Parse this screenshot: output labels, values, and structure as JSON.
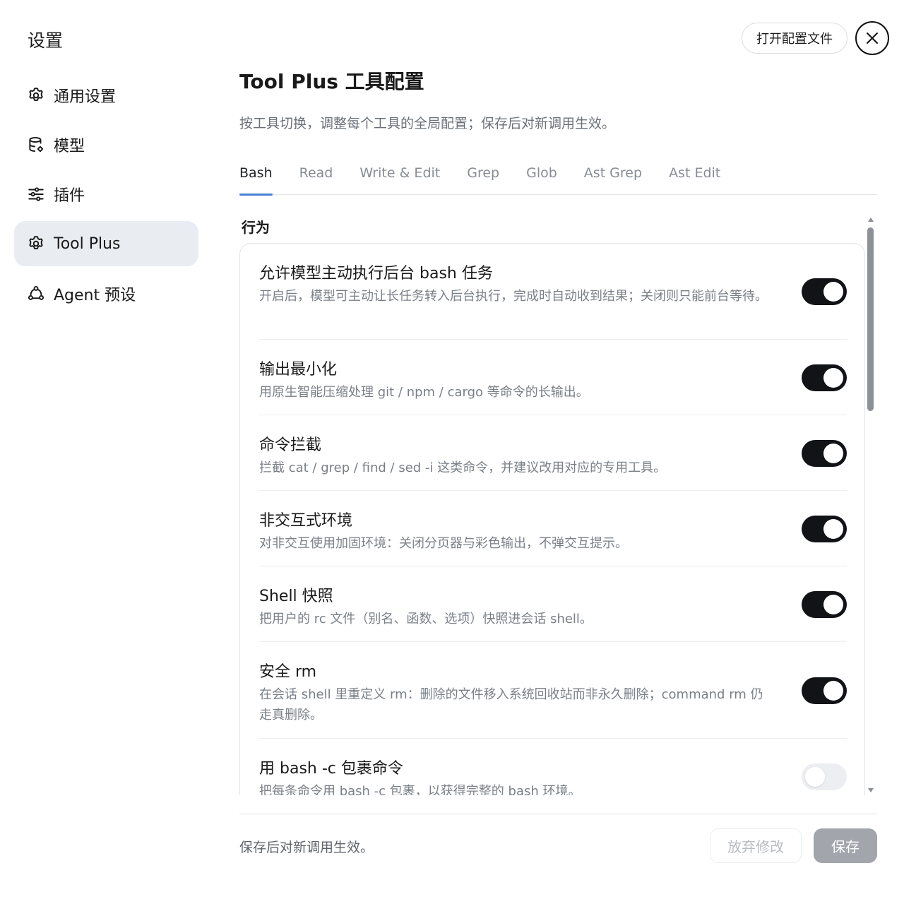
{
  "sidebar": {
    "title": "设置",
    "items": [
      {
        "label": "通用设置",
        "icon": "gear-icon",
        "active": false
      },
      {
        "label": "模型",
        "icon": "database-icon",
        "active": false
      },
      {
        "label": "插件",
        "icon": "sliders-icon",
        "active": false
      },
      {
        "label": "Tool Plus",
        "icon": "gear-icon",
        "active": true
      },
      {
        "label": "Agent 预设",
        "icon": "agent-nodes-icon",
        "active": false
      }
    ]
  },
  "header": {
    "open_config_label": "打开配置文件",
    "close_icon": "close-icon"
  },
  "main": {
    "title": "Tool Plus 工具配置",
    "subtitle": "按工具切换，调整每个工具的全局配置；保存后对新调用生效。",
    "tabs": [
      {
        "label": "Bash",
        "active": true
      },
      {
        "label": "Read",
        "active": false
      },
      {
        "label": "Write & Edit",
        "active": false
      },
      {
        "label": "Grep",
        "active": false
      },
      {
        "label": "Glob",
        "active": false
      },
      {
        "label": "Ast Grep",
        "active": false
      },
      {
        "label": "Ast Edit",
        "active": false
      }
    ],
    "section_label": "行为",
    "settings": [
      {
        "title": "允许模型主动执行后台 bash 任务",
        "desc": "开启后，模型可主动让长任务转入后台执行，完成时自动收到结果；关闭则只能前台等待。",
        "enabled": true
      },
      {
        "title": "输出最小化",
        "desc": "用原生智能压缩处理 git / npm / cargo 等命令的长输出。",
        "enabled": true
      },
      {
        "title": "命令拦截",
        "desc": "拦截 cat / grep / find / sed -i 这类命令，并建议改用对应的专用工具。",
        "enabled": true
      },
      {
        "title": "非交互式环境",
        "desc": "对非交互使用加固环境：关闭分页器与彩色输出，不弹交互提示。",
        "enabled": true
      },
      {
        "title": "Shell 快照",
        "desc": "把用户的 rc 文件（别名、函数、选项）快照进会话 shell。",
        "enabled": true
      },
      {
        "title": "安全 rm",
        "desc": "在会话 shell 里重定义 rm：删除的文件移入系统回收站而非永久删除；command rm 仍走真删除。",
        "enabled": true
      },
      {
        "title": "用 bash -c 包裹命令",
        "desc": "把每条命令用 bash -c 包裹，以获得完整的 bash 环境。",
        "enabled": false
      }
    ]
  },
  "footer": {
    "note": "保存后对新调用生效。",
    "discard_label": "放弃修改",
    "save_label": "保存"
  }
}
